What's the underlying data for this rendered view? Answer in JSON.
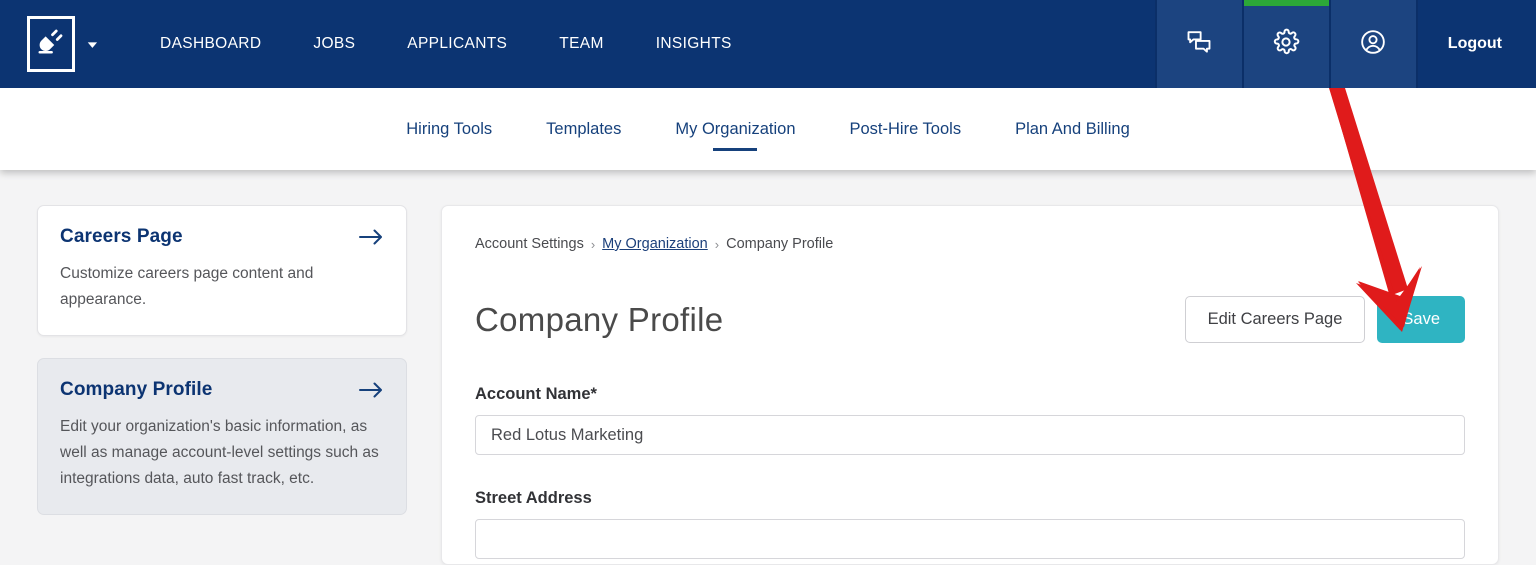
{
  "brand": {
    "logo_icon": "plug-logo-icon",
    "navy": "#0c3472",
    "teal": "#2fb4c2",
    "green": "#2ca838",
    "annotation_red": "#e01b1b"
  },
  "topnav": {
    "items": [
      {
        "label": "DASHBOARD"
      },
      {
        "label": "JOBS"
      },
      {
        "label": "APPLICANTS"
      },
      {
        "label": "TEAM"
      },
      {
        "label": "INSIGHTS"
      }
    ],
    "icons": [
      {
        "name": "chat-icon"
      },
      {
        "name": "gear-icon",
        "active": true
      },
      {
        "name": "account-icon"
      }
    ],
    "logout_label": "Logout"
  },
  "subnav": {
    "items": [
      {
        "label": "Hiring Tools",
        "active": false
      },
      {
        "label": "Templates",
        "active": false
      },
      {
        "label": "My Organization",
        "active": true
      },
      {
        "label": "Post-Hire Tools",
        "active": false
      },
      {
        "label": "Plan And Billing",
        "active": false
      }
    ]
  },
  "sidebar": {
    "cards": [
      {
        "title": "Careers Page",
        "desc": "Customize careers page content and appearance.",
        "selected": false
      },
      {
        "title": "Company Profile",
        "desc": "Edit your organization's basic information, as well as manage account-level settings such as integrations data, auto fast track, etc.",
        "selected": true
      }
    ]
  },
  "main": {
    "breadcrumb": {
      "root": "Account Settings",
      "sep": "›",
      "link": "My Organization",
      "current": "Company Profile"
    },
    "title": "Company Profile",
    "actions": {
      "secondary_label": "Edit Careers Page",
      "primary_label": "Save"
    },
    "fields": [
      {
        "label": "Account Name*",
        "value": "Red Lotus Marketing",
        "placeholder": ""
      },
      {
        "label": "Street Address",
        "value": "",
        "placeholder": ""
      }
    ]
  }
}
